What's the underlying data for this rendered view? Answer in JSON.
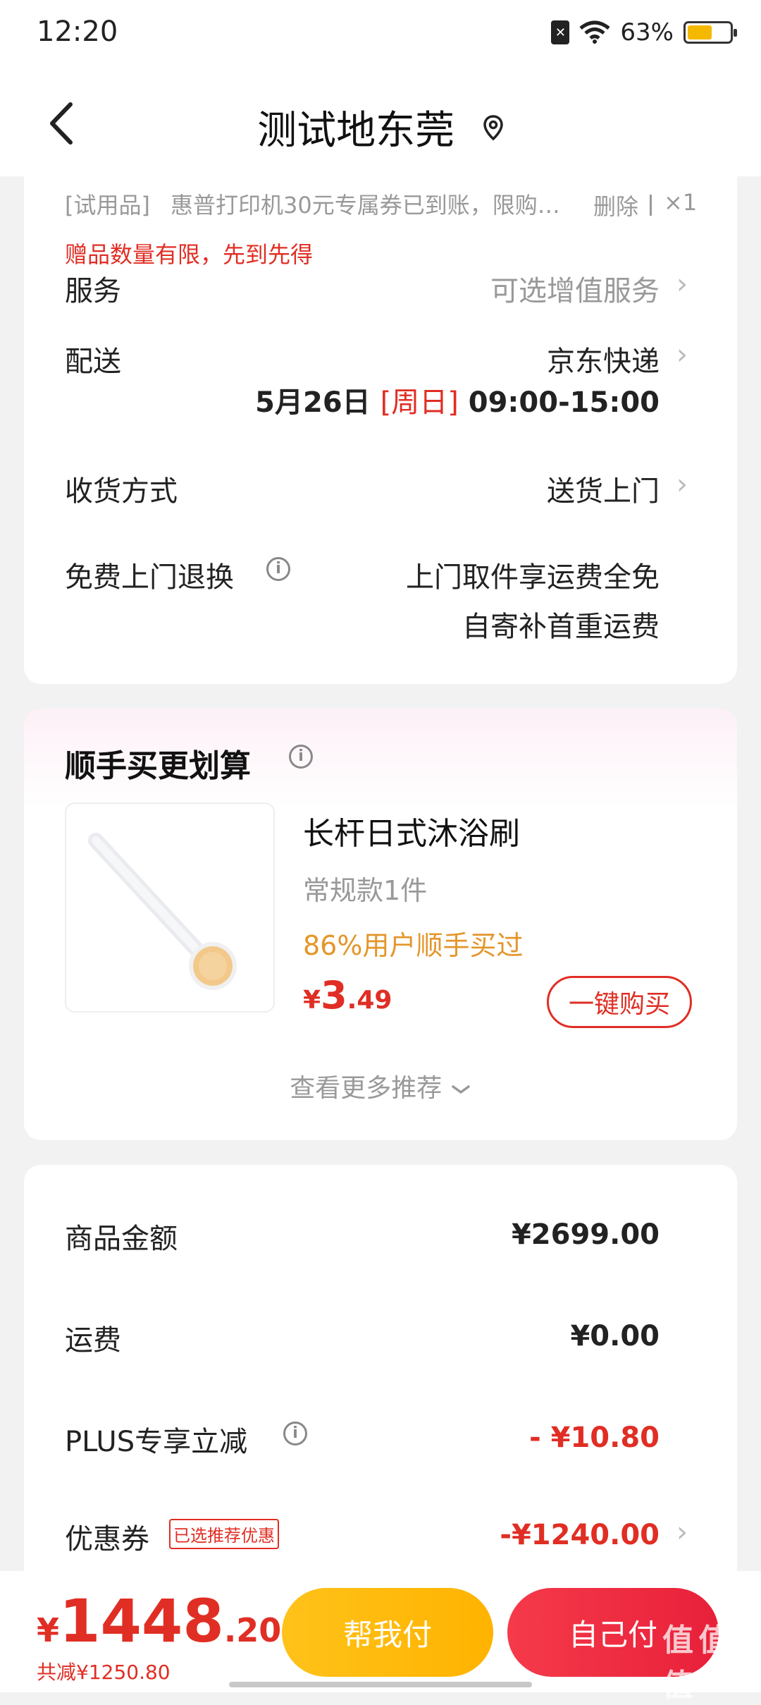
{
  "status": {
    "time": "12:20",
    "battery": "63%",
    "battery_level": 0.63
  },
  "header": {
    "title": "测试地东莞"
  },
  "gift": {
    "tag": "[试用品]",
    "text": "惠普打印机30元专属券已到账，限购…",
    "delete": "删除",
    "qty": "×1",
    "notice": "赠品数量有限，先到先得"
  },
  "service": {
    "label": "服务",
    "value": "可选增值服务"
  },
  "delivery": {
    "label": "配送",
    "value": "京东快递",
    "date": "5月26日",
    "weekday": "[周日]",
    "time": "09:00-15:00"
  },
  "receive": {
    "label": "收货方式",
    "value": "送货上门"
  },
  "returns": {
    "label": "免费上门退换",
    "line1": "上门取件享运费全免",
    "line2": "自寄补首重运费"
  },
  "addon": {
    "title": "顺手买更划算",
    "product_name": "长杆日式沐浴刷",
    "spec": "常规款1件",
    "social": "86%用户顺手买过",
    "price_symbol": "¥",
    "price_int": "3",
    "price_dec": ".49",
    "buy_label": "一键购买",
    "more": "查看更多推荐"
  },
  "summary": {
    "goods_label": "商品金额",
    "goods_value": "¥2699.00",
    "ship_label": "运费",
    "ship_value": "¥0.00",
    "plus_label": "PLUS专享立减",
    "plus_value": "- ¥10.80",
    "coupon_label": "优惠券",
    "coupon_badge": "已选推荐优惠",
    "coupon_value": "-¥1240.00"
  },
  "footer": {
    "price_symbol": "¥",
    "price_int": "1448",
    "price_dec": ".20",
    "saved": "共减¥1250.80",
    "friend_pay": "帮我付",
    "self_pay": "自己付"
  },
  "watermark": "值 值 值",
  "colors": {
    "accent": "#e02e24",
    "orange": "#e3962a",
    "yellow_btn": "#ffb300"
  }
}
